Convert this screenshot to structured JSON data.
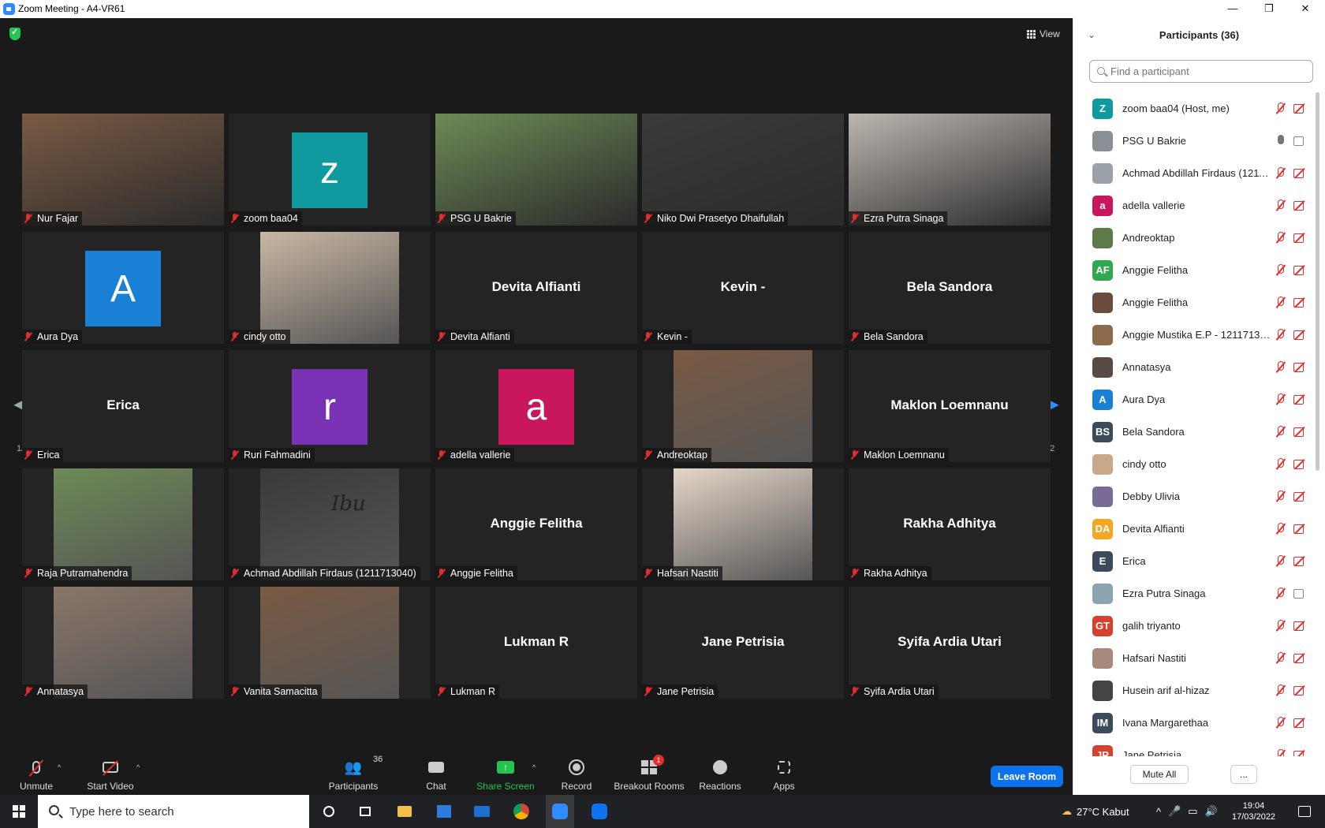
{
  "window": {
    "title": "Zoom Meeting - A4-VR61",
    "minimize": "—",
    "maximize": "❐",
    "close": "✕"
  },
  "view_button": "View",
  "pagination": {
    "left": "1/2",
    "right": "1/2"
  },
  "tiles": [
    {
      "name": "Nur Fajar",
      "kind": "video"
    },
    {
      "name": "zoom baa04",
      "kind": "avatar",
      "letter": "z",
      "color": "#0e9a9f"
    },
    {
      "name": "PSG U Bakrie",
      "kind": "video",
      "active": true
    },
    {
      "name": "Niko Dwi Prasetyo Dhaifullah",
      "kind": "video"
    },
    {
      "name": "Ezra Putra Sinaga",
      "kind": "video"
    },
    {
      "name": "Aura Dya",
      "kind": "avatar",
      "letter": "A",
      "color": "#1a80d6"
    },
    {
      "name": "cindy otto",
      "kind": "photo"
    },
    {
      "name": "Devita Alfianti",
      "kind": "name"
    },
    {
      "name": "Kevin -",
      "kind": "name"
    },
    {
      "name": "Bela Sandora",
      "kind": "name"
    },
    {
      "name": "Erica",
      "kind": "name"
    },
    {
      "name": "Ruri Fahmadini",
      "kind": "avatar",
      "letter": "r",
      "color": "#7a32b4"
    },
    {
      "name": "adella vallerie",
      "kind": "avatar",
      "letter": "a",
      "color": "#c8175d"
    },
    {
      "name": "Andreoktap",
      "kind": "photo"
    },
    {
      "name": "Maklon Loemnanu",
      "kind": "name"
    },
    {
      "name": "Raja Putramahendra",
      "kind": "photo"
    },
    {
      "name": "Achmad Abdillah Firdaus (1211713040)",
      "kind": "photo",
      "overlay_text": "Ibu"
    },
    {
      "name": "Anggie Felitha",
      "kind": "name"
    },
    {
      "name": "Hafsari Nastiti",
      "kind": "photo"
    },
    {
      "name": "Rakha Adhitya",
      "kind": "name"
    },
    {
      "name": "Annatasya",
      "kind": "photo"
    },
    {
      "name": "Vanita Samacitta",
      "kind": "photo"
    },
    {
      "name": "Lukman R",
      "kind": "name"
    },
    {
      "name": "Jane Petrisia",
      "kind": "name"
    },
    {
      "name": "Syifa Ardia Utari",
      "kind": "name"
    }
  ],
  "toolbar": {
    "unmute": "Unmute",
    "start_video": "Start Video",
    "participants": "Participants",
    "participants_count": "36",
    "chat": "Chat",
    "share_screen": "Share Screen",
    "record": "Record",
    "breakout_rooms": "Breakout Rooms",
    "breakout_badge": "1",
    "reactions": "Reactions",
    "apps": "Apps",
    "leave_room": "Leave Room"
  },
  "panel": {
    "title": "Participants (36)",
    "search_placeholder": "Find a participant",
    "mute_all": "Mute All",
    "more": "...",
    "participants": [
      {
        "name": "zoom baa04 (Host, me)",
        "initials": "Z",
        "color": "#0e9a9f",
        "mic": "off",
        "cam": "off"
      },
      {
        "name": "PSG U Bakrie",
        "initials": "",
        "color": "#8a8f96",
        "mic": "on",
        "cam": "on"
      },
      {
        "name": "Achmad Abdillah Firdaus (1211...",
        "initials": "",
        "color": "#9aa1a8",
        "mic": "off",
        "cam": "off"
      },
      {
        "name": "adella vallerie",
        "initials": "a",
        "color": "#c8175d",
        "mic": "off",
        "cam": "off"
      },
      {
        "name": "Andreoktap",
        "initials": "",
        "color": "#5e7a4a",
        "mic": "off",
        "cam": "off"
      },
      {
        "name": "Anggie Felitha",
        "initials": "AF",
        "color": "#2fa84f",
        "mic": "off",
        "cam": "off"
      },
      {
        "name": "Anggie Felitha",
        "initials": "",
        "color": "#6b4b3e",
        "mic": "off",
        "cam": "off"
      },
      {
        "name": "Anggie Mustika E.P - 12117130...",
        "initials": "",
        "color": "#8c6b4a",
        "mic": "off",
        "cam": "off"
      },
      {
        "name": "Annatasya",
        "initials": "",
        "color": "#5a4a44",
        "mic": "off",
        "cam": "off"
      },
      {
        "name": "Aura Dya",
        "initials": "A",
        "color": "#1a80d6",
        "mic": "off",
        "cam": "off"
      },
      {
        "name": "Bela Sandora",
        "initials": "BS",
        "color": "#3c4b5c",
        "mic": "off",
        "cam": "off"
      },
      {
        "name": "cindy otto",
        "initials": "",
        "color": "#c9a889",
        "mic": "off",
        "cam": "off"
      },
      {
        "name": "Debby Ulivia",
        "initials": "",
        "color": "#7a6a9a",
        "mic": "off",
        "cam": "off"
      },
      {
        "name": "Devita Alfianti",
        "initials": "DA",
        "color": "#f5a623",
        "mic": "off",
        "cam": "off"
      },
      {
        "name": "Erica",
        "initials": "E",
        "color": "#3c4b5c",
        "mic": "off",
        "cam": "off"
      },
      {
        "name": "Ezra Putra Sinaga",
        "initials": "",
        "color": "#8aa4b0",
        "mic": "off",
        "cam": "on"
      },
      {
        "name": "galih triyanto",
        "initials": "GT",
        "color": "#d6402f",
        "mic": "off",
        "cam": "off"
      },
      {
        "name": "Hafsari Nastiti",
        "initials": "",
        "color": "#a88a7a",
        "mic": "off",
        "cam": "off"
      },
      {
        "name": "Husein arif al-hizaz",
        "initials": "",
        "color": "#444",
        "mic": "off",
        "cam": "off"
      },
      {
        "name": "Ivana Margarethaa",
        "initials": "IM",
        "color": "#3c4b5c",
        "mic": "off",
        "cam": "off"
      },
      {
        "name": "Jane Petrisia",
        "initials": "JP",
        "color": "#d6402f",
        "mic": "off",
        "cam": "off"
      }
    ]
  },
  "taskbar": {
    "search_placeholder": "Type here to search",
    "weather": "27°C  Kabut",
    "time": "19:04",
    "date": "17/03/2022"
  }
}
